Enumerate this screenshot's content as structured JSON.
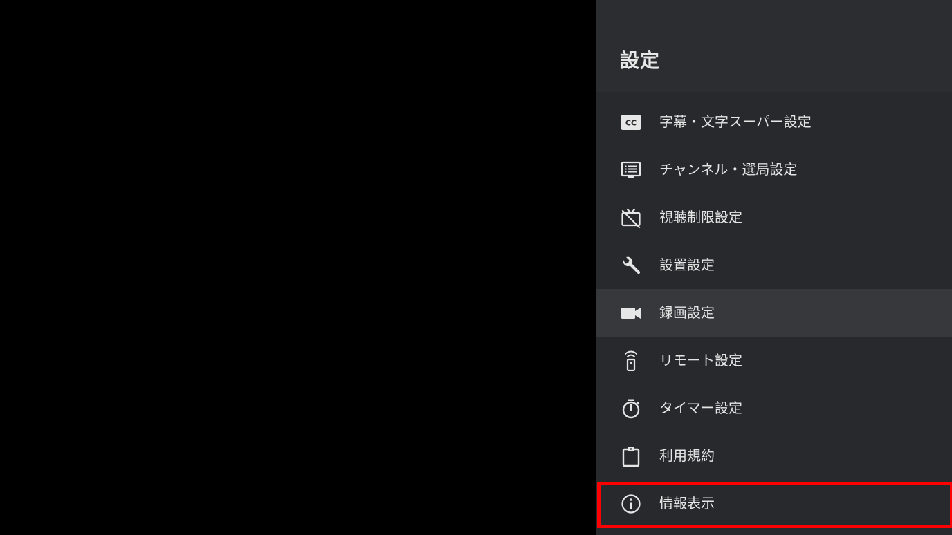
{
  "settings_panel": {
    "title": "設定",
    "items": [
      {
        "label": "字幕・文字スーパー設定",
        "icon": "closed-caption-icon"
      },
      {
        "label": "チャンネル・選局設定",
        "icon": "channel-list-icon"
      },
      {
        "label": "視聴制限設定",
        "icon": "tv-off-icon"
      },
      {
        "label": "設置設定",
        "icon": "wrench-icon"
      },
      {
        "label": "録画設定",
        "icon": "video-camera-icon"
      },
      {
        "label": "リモート設定",
        "icon": "remote-control-icon"
      },
      {
        "label": "タイマー設定",
        "icon": "timer-icon"
      },
      {
        "label": "利用規約",
        "icon": "clipboard-icon"
      },
      {
        "label": "情報表示",
        "icon": "info-icon"
      }
    ],
    "active_item": "録画設定",
    "highlighted_item": "情報表示"
  },
  "colors": {
    "background": "#000000",
    "panel": "#28292c",
    "panel_header": "#2c2d30",
    "active_row": "#37383b",
    "text": "#e6e6e6",
    "highlight_border": "#ff0000"
  }
}
